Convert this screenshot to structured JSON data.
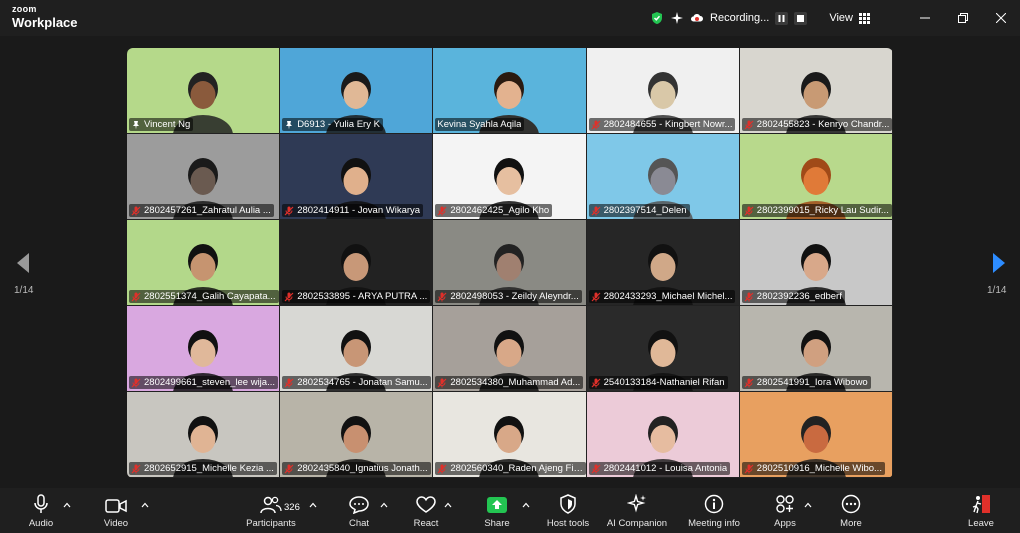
{
  "app": {
    "brand_small": "zoom",
    "brand_large": "Workplace"
  },
  "titlebar": {
    "recording_label": "Recording...",
    "view_label": "View"
  },
  "pagination": {
    "left": "1/14",
    "right": "1/14"
  },
  "tiles": [
    {
      "name": "Vincent Ng",
      "icon": "pin",
      "bg": "#b5d98a",
      "skin": "#8a5a3c",
      "hair": "#222"
    },
    {
      "name": "D6913 - Yulia Ery K",
      "icon": "pin",
      "bg": "#4fa6d8",
      "skin": "#e0b896",
      "hair": "#1a1a1a"
    },
    {
      "name": "Kevina Syahla Aqila",
      "icon": "none",
      "bg": "#5ab4dc",
      "skin": "#e3b28f",
      "hair": "#2a1a10",
      "active": true
    },
    {
      "name": "2802484655 - Kingbert Nowr...",
      "icon": "mic",
      "bg": "#f0f0f0",
      "skin": "#d9c8a8",
      "hair": "#333"
    },
    {
      "name": "2802455823 - Kenryo Chandr...",
      "icon": "mic",
      "bg": "#d8d6cf",
      "skin": "#c89a74",
      "hair": "#1a1a1a"
    },
    {
      "name": "2802457261_Zahratul Aulia ...",
      "icon": "mic",
      "bg": "#9c9c9c",
      "skin": "#6a5a50",
      "hair": "#1a1a1a"
    },
    {
      "name": "2802414911 - Jovan Wikarya",
      "icon": "mic",
      "bg": "#2f3a55",
      "skin": "#e0b08c",
      "hair": "#111"
    },
    {
      "name": "2802462425_Agilo Kho",
      "icon": "mic",
      "bg": "#f4f4f4",
      "skin": "#e6bfa0",
      "hair": "#111"
    },
    {
      "name": "2802397514_Delen",
      "icon": "mic",
      "bg": "#7fc8e8",
      "skin": "#8a8a94",
      "hair": "#555"
    },
    {
      "name": "2802399015_Ricky Lau Sudir...",
      "icon": "mic",
      "bg": "#b8d98c",
      "skin": "#e07a38",
      "hair": "#a04a18"
    },
    {
      "name": "2802551374_Galih Cayapata...",
      "icon": "mic",
      "bg": "#b3d88a",
      "skin": "#c69470",
      "hair": "#111"
    },
    {
      "name": "2802533895 - ARYA PUTRA ...",
      "icon": "mic",
      "bg": "#222222",
      "skin": "#c89878",
      "hair": "#111"
    },
    {
      "name": "2802498053 - Zeildy Aleyndr...",
      "icon": "mic",
      "bg": "#8a8a84",
      "skin": "#a08070",
      "hair": "#222"
    },
    {
      "name": "2802433293_Michael Michel...",
      "icon": "mic",
      "bg": "#262626",
      "skin": "#d0a888",
      "hair": "#111"
    },
    {
      "name": "2802392236_edberf",
      "icon": "mic",
      "bg": "#c8c8c8",
      "skin": "#d8a88a",
      "hair": "#111"
    },
    {
      "name": "2802499661_steven_lee wija...",
      "icon": "mic",
      "bg": "#d9a8e0",
      "skin": "#e0b89a",
      "hair": "#111"
    },
    {
      "name": "2802534765 - Jonatan Samu...",
      "icon": "mic",
      "bg": "#d8d8d4",
      "skin": "#c89676",
      "hair": "#111"
    },
    {
      "name": "2802534380_Muhammad Ad...",
      "icon": "mic",
      "bg": "#a6a09a",
      "skin": "#d8a888",
      "hair": "#111"
    },
    {
      "name": "2540133184-Nathaniel Rifan",
      "icon": "mic",
      "bg": "#2a2a2a",
      "skin": "#e0b898",
      "hair": "#111"
    },
    {
      "name": "2802541991_Iora Wibowo",
      "icon": "mic",
      "bg": "#b8b6ae",
      "skin": "#d0a080",
      "hair": "#111"
    },
    {
      "name": "2802652915_Michelle Kezia ...",
      "icon": "mic",
      "bg": "#c8c6c0",
      "skin": "#e0b494",
      "hair": "#111"
    },
    {
      "name": "2802435840_Ignatius Jonath...",
      "icon": "mic",
      "bg": "#b8b4a8",
      "skin": "#c89070",
      "hair": "#111"
    },
    {
      "name": "2802560340_Raden Ajeng Fil...",
      "icon": "mic",
      "bg": "#e8e6e0",
      "skin": "#d8a888",
      "hair": "#111"
    },
    {
      "name": "2802441012 - Louisa Antonia",
      "icon": "mic",
      "bg": "#eccbd8",
      "skin": "#e6bca0",
      "hair": "#222"
    },
    {
      "name": "2802510916_Michelle Wibo...",
      "icon": "mic",
      "bg": "#e8a060",
      "skin": "#c96a40",
      "hair": "#222"
    }
  ],
  "toolbar": {
    "audio": "Audio",
    "video": "Video",
    "participants": "Participants",
    "participants_count": "326",
    "chat": "Chat",
    "react": "React",
    "share": "Share",
    "host_tools": "Host tools",
    "ai_companion": "AI Companion",
    "meeting_info": "Meeting info",
    "apps": "Apps",
    "more": "More",
    "leave": "Leave"
  },
  "colors": {
    "share_accent": "#23c552",
    "mic_off": "#e0302a",
    "active_speaker": "#23d96e",
    "leave": "#e0302a"
  }
}
